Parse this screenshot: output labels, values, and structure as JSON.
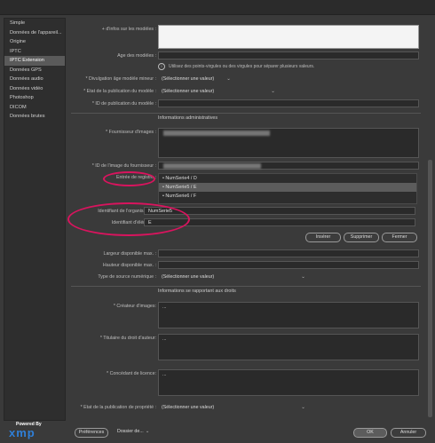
{
  "sidebar": {
    "items": [
      {
        "label": "Simple",
        "active": false
      },
      {
        "label": "Données de l'appareil...",
        "active": false
      },
      {
        "label": "Origine",
        "active": false
      },
      {
        "label": "IPTC",
        "active": false
      },
      {
        "label": "IPTC Extension",
        "active": true
      },
      {
        "label": "Données GPS",
        "active": false
      },
      {
        "label": "Données audio",
        "active": false
      },
      {
        "label": "Données vidéo",
        "active": false
      },
      {
        "label": "Photoshop",
        "active": false
      },
      {
        "label": "DICOM",
        "active": false
      },
      {
        "label": "Données brutes",
        "active": false
      }
    ]
  },
  "form": {
    "models_info_label": "+ d'infos sur les modèles :",
    "models_age_label": "Age des modèles :",
    "models_age_note": "Utilisez des points-virgules ou des virgules pour séparer plusieurs valeurs.",
    "minor_disclosure_label": "* Divulgation âge modèle mineur :",
    "minor_disclosure_value": "(Sélectionner une valeur)",
    "model_release_status_label": "* Etat de la publication du modèle :",
    "model_release_status_value": "(Sélectionner une valeur)",
    "model_release_id_label": "* ID de publication du modèle :"
  },
  "admin": {
    "section_title": "Informations administratives",
    "image_supplier_label": "* Fournisseur d'images :",
    "supplier_image_id_label": "* ID de l'image du fournisseur :",
    "registry_entry_label": "Entrée de registre :",
    "registry_items": [
      {
        "label": "NumSerie4 / D",
        "selected": false
      },
      {
        "label": "NumSerie5 / E",
        "selected": true
      },
      {
        "label": "NumSerie6 / F",
        "selected": false
      }
    ],
    "org_id_label": "Identifiant de l'organisation :",
    "org_id_value": "NumSerie5",
    "item_id_label": "Identifiant d'élément :",
    "item_id_value": "E",
    "insert_button": "Insérer",
    "delete_button": "Supprimer",
    "close_button": "Fermer",
    "max_width_label": "Largeur disponible max. :",
    "max_height_label": "Hauteur disponible max. :",
    "digital_source_label": "Type de source numérique :",
    "digital_source_value": "(Sélectionner une valeur)"
  },
  "rights": {
    "section_title": "Informations se rapportant aux droits",
    "creator_label": "* Créateur d'images:",
    "creator_value": "...",
    "copyright_owner_label": "* Titulaire du droit d'auteur:",
    "copyright_owner_value": "...",
    "licensor_label": "* Concédant de licence:",
    "licensor_value": "...",
    "property_release_label": "* Etat de la publication de propriété :",
    "property_release_value": "(Sélectionner une valeur)"
  },
  "footer": {
    "powered_by": "Powered By",
    "xmp_logo": "xmp",
    "preferences_button": "Préférences",
    "folder_button": "Dossier de...",
    "ok_button": "OK",
    "cancel_button": "Annuler"
  },
  "colors": {
    "annotation_circle": "#d9145e",
    "background": "#3a3a3a",
    "xmp_blue": "#2f7fd8"
  }
}
